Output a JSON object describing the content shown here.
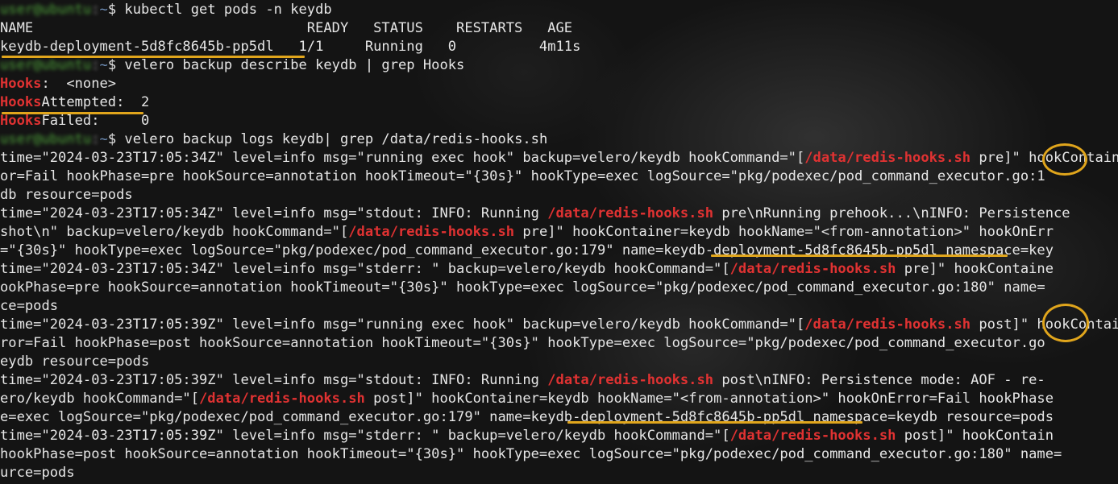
{
  "prompt": {
    "userhost": "user@ubuntu",
    "path": "~",
    "dollar": "$"
  },
  "lines": [
    {
      "kind": "prompt",
      "cmd": " kubectl get pods -n keydb"
    },
    {
      "kind": "text",
      "parts": [
        {
          "t": "NAME                                 READY   STATUS    RESTARTS   AGE"
        }
      ]
    },
    {
      "kind": "text",
      "parts": [
        {
          "t": "keydb-deployment-5d8fc8645b-pp5dl   1/1     Running   0          4m11s"
        }
      ]
    },
    {
      "kind": "prompt",
      "cmd": " velero backup describe keydb | grep Hooks"
    },
    {
      "kind": "text",
      "parts": [
        {
          "t": "Hooks",
          "c": "hl"
        },
        {
          "t": ":  <none>"
        }
      ]
    },
    {
      "kind": "text",
      "parts": [
        {
          "t": "Hooks",
          "c": "hl"
        },
        {
          "t": "Attempted:  2"
        }
      ]
    },
    {
      "kind": "text",
      "parts": [
        {
          "t": "Hooks",
          "c": "hl"
        },
        {
          "t": "Failed:     0"
        }
      ]
    },
    {
      "kind": "prompt",
      "cmd": " velero backup logs keydb| grep /data/redis-hooks.sh"
    },
    {
      "kind": "text",
      "parts": [
        {
          "t": "time=\"2024-03-23T17:05:34Z\" level=info msg=\"running exec hook\" backup=velero/keydb hookCommand=\"["
        },
        {
          "t": "/data/redis-hooks.sh",
          "c": "hl"
        },
        {
          "t": " pre]\" hookContainer=keydb hookName=\"<from-annotation>\" hookOnErr"
        }
      ]
    },
    {
      "kind": "text",
      "parts": [
        {
          "t": "or=Fail hookPhase=pre hookSource=annotation hookTimeout=\"{30s}\" hookType=exec logSource=\"pkg/podexec/pod_command_executor.go:1"
        }
      ]
    },
    {
      "kind": "text",
      "parts": [
        {
          "t": "db resource=pods"
        }
      ]
    },
    {
      "kind": "text",
      "parts": [
        {
          "t": "time=\"2024-03-23T17:05:34Z\" level=info msg=\"stdout: INFO: Running "
        },
        {
          "t": "/data/redis-hooks.sh",
          "c": "hl"
        },
        {
          "t": " pre\\nRunning prehook...\\nINFO: Persistence"
        }
      ]
    },
    {
      "kind": "text",
      "parts": [
        {
          "t": "shot\\n\" backup=velero/keydb hookCommand=\"["
        },
        {
          "t": "/data/redis-hooks.sh",
          "c": "hl"
        },
        {
          "t": " pre]\" hookContainer=keydb hookName=\"<from-annotation>\" hookOnErr"
        }
      ]
    },
    {
      "kind": "text",
      "parts": [
        {
          "t": "=\"{30s}\" hookType=exec logSource=\"pkg/podexec/pod_command_executor.go:179\" name=keydb-deployment-5d8fc8645b-pp5dl namespace=key"
        }
      ]
    },
    {
      "kind": "text",
      "parts": [
        {
          "t": "time=\"2024-03-23T17:05:34Z\" level=info msg=\"stderr: \" backup=velero/keydb hookCommand=\"["
        },
        {
          "t": "/data/redis-hooks.sh",
          "c": "hl"
        },
        {
          "t": " pre]\" hookContaine"
        }
      ]
    },
    {
      "kind": "text",
      "parts": [
        {
          "t": "ookPhase=pre hookSource=annotation hookTimeout=\"{30s}\" hookType=exec logSource=\"pkg/podexec/pod_command_executor.go:180\" name="
        }
      ]
    },
    {
      "kind": "text",
      "parts": [
        {
          "t": "ce=pods"
        }
      ]
    },
    {
      "kind": "text",
      "parts": [
        {
          "t": "time=\"2024-03-23T17:05:39Z\" level=info msg=\"running exec hook\" backup=velero/keydb hookCommand=\"["
        },
        {
          "t": "/data/redis-hooks.sh",
          "c": "hl"
        },
        {
          "t": " post]\" hookContainer=keydb hookName=\"<from-annotation>\" hookOnEr"
        }
      ]
    },
    {
      "kind": "text",
      "parts": [
        {
          "t": "ror=Fail hookPhase=post hookSource=annotation hookTimeout=\"{30s}\" hookType=exec logSource=\"pkg/podexec/pod_command_executor.go"
        }
      ]
    },
    {
      "kind": "text",
      "parts": [
        {
          "t": "eydb resource=pods"
        }
      ]
    },
    {
      "kind": "text",
      "parts": [
        {
          "t": "time=\"2024-03-23T17:05:39Z\" level=info msg=\"stdout: INFO: Running "
        },
        {
          "t": "/data/redis-hooks.sh",
          "c": "hl"
        },
        {
          "t": " post\\nINFO: Persistence mode: AOF - re-"
        }
      ]
    },
    {
      "kind": "text",
      "parts": [
        {
          "t": "ero/keydb hookCommand=\"["
        },
        {
          "t": "/data/redis-hooks.sh",
          "c": "hl"
        },
        {
          "t": " post]\" hookContainer=keydb hookName=\"<from-annotation>\" hookOnError=Fail hookPhase"
        }
      ]
    },
    {
      "kind": "text",
      "parts": [
        {
          "t": "e=exec logSource=\"pkg/podexec/pod_command_executor.go:179\" name=keydb-deployment-5d8fc8645b-pp5dl namespace=keydb resource=pods"
        }
      ]
    },
    {
      "kind": "text",
      "parts": [
        {
          "t": "time=\"2024-03-23T17:05:39Z\" level=info msg=\"stderr: \" backup=velero/keydb hookCommand=\"["
        },
        {
          "t": "/data/redis-hooks.sh",
          "c": "hl"
        },
        {
          "t": " post]\" hookContain"
        }
      ]
    },
    {
      "kind": "text",
      "parts": [
        {
          "t": "hookPhase=post hookSource=annotation hookTimeout=\"{30s}\" hookType=exec logSource=\"pkg/podexec/pod_command_executor.go:180\" name="
        }
      ]
    },
    {
      "kind": "text",
      "parts": [
        {
          "t": "urce=pods"
        }
      ]
    }
  ],
  "colors": {
    "text": "#e6e6e6",
    "prompt_green": "#4ea33a",
    "highlight_red": "#e03232",
    "annotation_orange": "#e0a51c",
    "background": "#141414"
  }
}
